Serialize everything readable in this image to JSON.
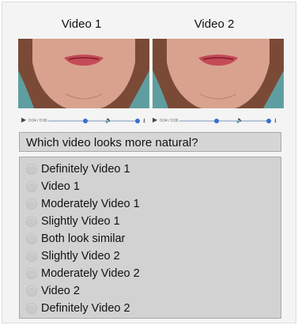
{
  "panels": [
    {
      "title": "Video 1",
      "time": "0:04 / 0:06"
    },
    {
      "title": "Video 2",
      "time": "0:04 / 0:06"
    }
  ],
  "question": "Which video looks more natural?",
  "options": [
    "Definitely Video 1",
    "Video 1",
    "Moderately Video 1",
    "Slightly Video 1",
    "Both look similar",
    "Slightly Video 2",
    "Moderately Video 2",
    "Video 2",
    "Definitely Video 2"
  ],
  "colors": {
    "video_background": "#5f9ea0",
    "accent": "#3a6fd0"
  },
  "icons": {
    "play": "play-icon",
    "volume": "volume-icon",
    "download": "download-icon",
    "radio": "radio-icon"
  }
}
